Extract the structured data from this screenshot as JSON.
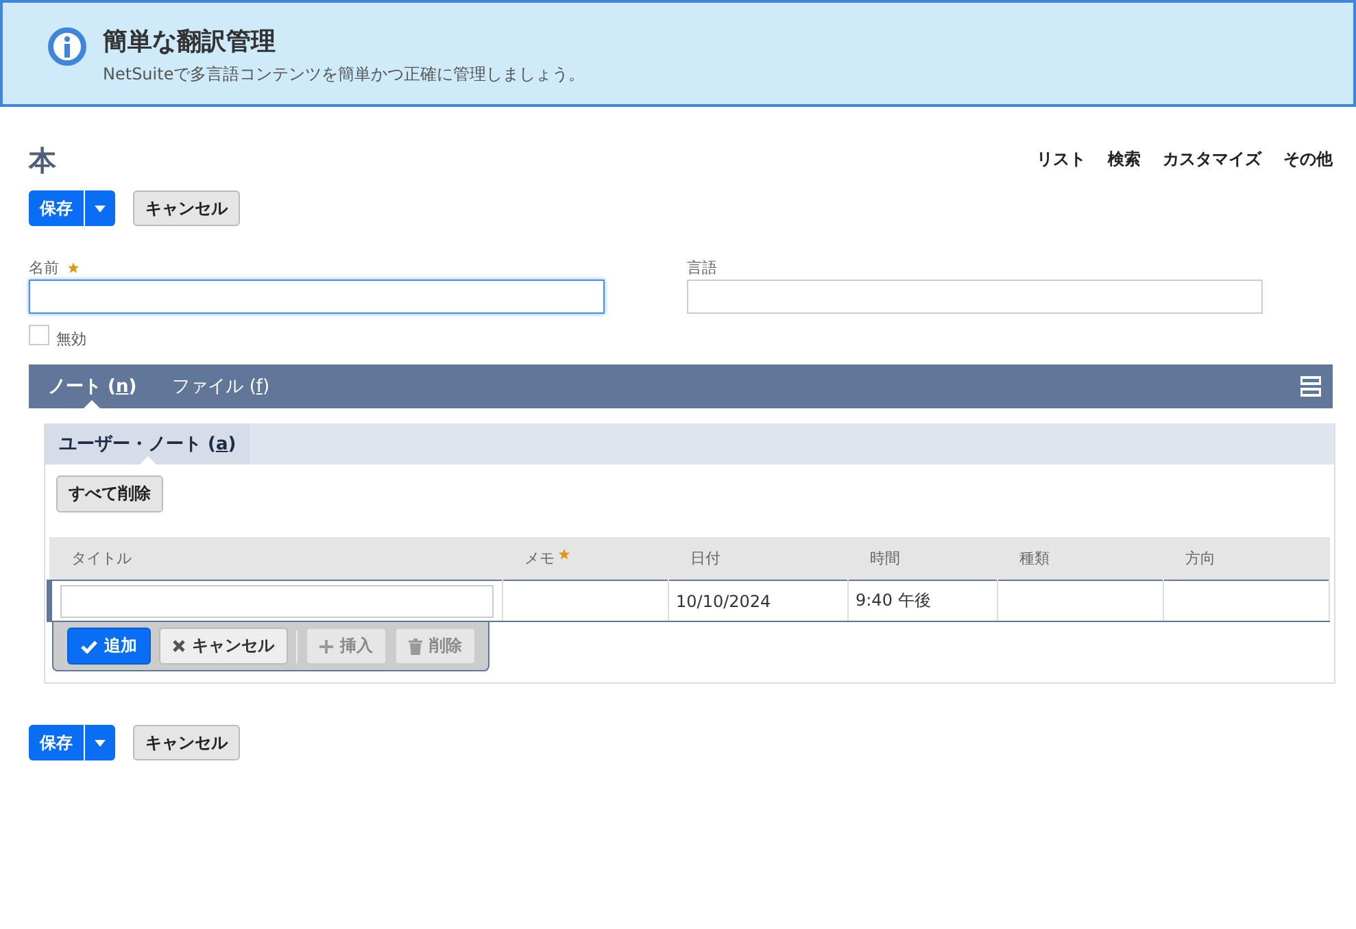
{
  "banner": {
    "title": "簡単な翻訳管理",
    "message": "NetSuiteで多言語コンテンツを簡単かつ正確に管理しましょう。"
  },
  "page_title": "本",
  "nav_links": [
    "リスト",
    "検索",
    "カスタマイズ",
    "その他"
  ],
  "top_buttons": {
    "save": "保存",
    "cancel": "キャンセル"
  },
  "fields": [
    {
      "label": "名前",
      "required": true,
      "focused": true
    },
    {
      "label": "言語",
      "required": false,
      "focused": false
    }
  ],
  "inactive_checkbox": {
    "label": "無効",
    "checked": false
  },
  "tabs": [
    {
      "label": "ノート",
      "open": "(",
      "key": "n",
      "close": ")",
      "selected": true
    },
    {
      "label": "ファイル",
      "open": "(",
      "key": "f",
      "close": ")",
      "selected": false
    }
  ],
  "subtabs": [
    {
      "label": "ユーザー・ノート",
      "open": "(",
      "key": "a",
      "close": ")",
      "selected": true
    }
  ],
  "remove_all_button": "すべて削除",
  "table": {
    "columns": [
      {
        "label": "タイトル",
        "required": false
      },
      {
        "label": "メモ",
        "required": true
      },
      {
        "label": "日付",
        "required": false
      },
      {
        "label": "時間",
        "required": false
      },
      {
        "label": "種類",
        "required": false
      },
      {
        "label": "方向",
        "required": false
      }
    ],
    "edit_row": {
      "date": "10/10/2024",
      "time": "9:40 午後"
    },
    "row_actions": [
      {
        "kind": "add",
        "label": "追加",
        "disabled": false
      },
      {
        "kind": "cancel",
        "label": "キャンセル",
        "disabled": false
      },
      {
        "kind": "insert",
        "label": "挿入",
        "disabled": true
      },
      {
        "kind": "delete",
        "label": "削除",
        "disabled": true
      }
    ]
  },
  "bottom_buttons": {
    "save": "保存",
    "cancel": "キャンセル"
  }
}
